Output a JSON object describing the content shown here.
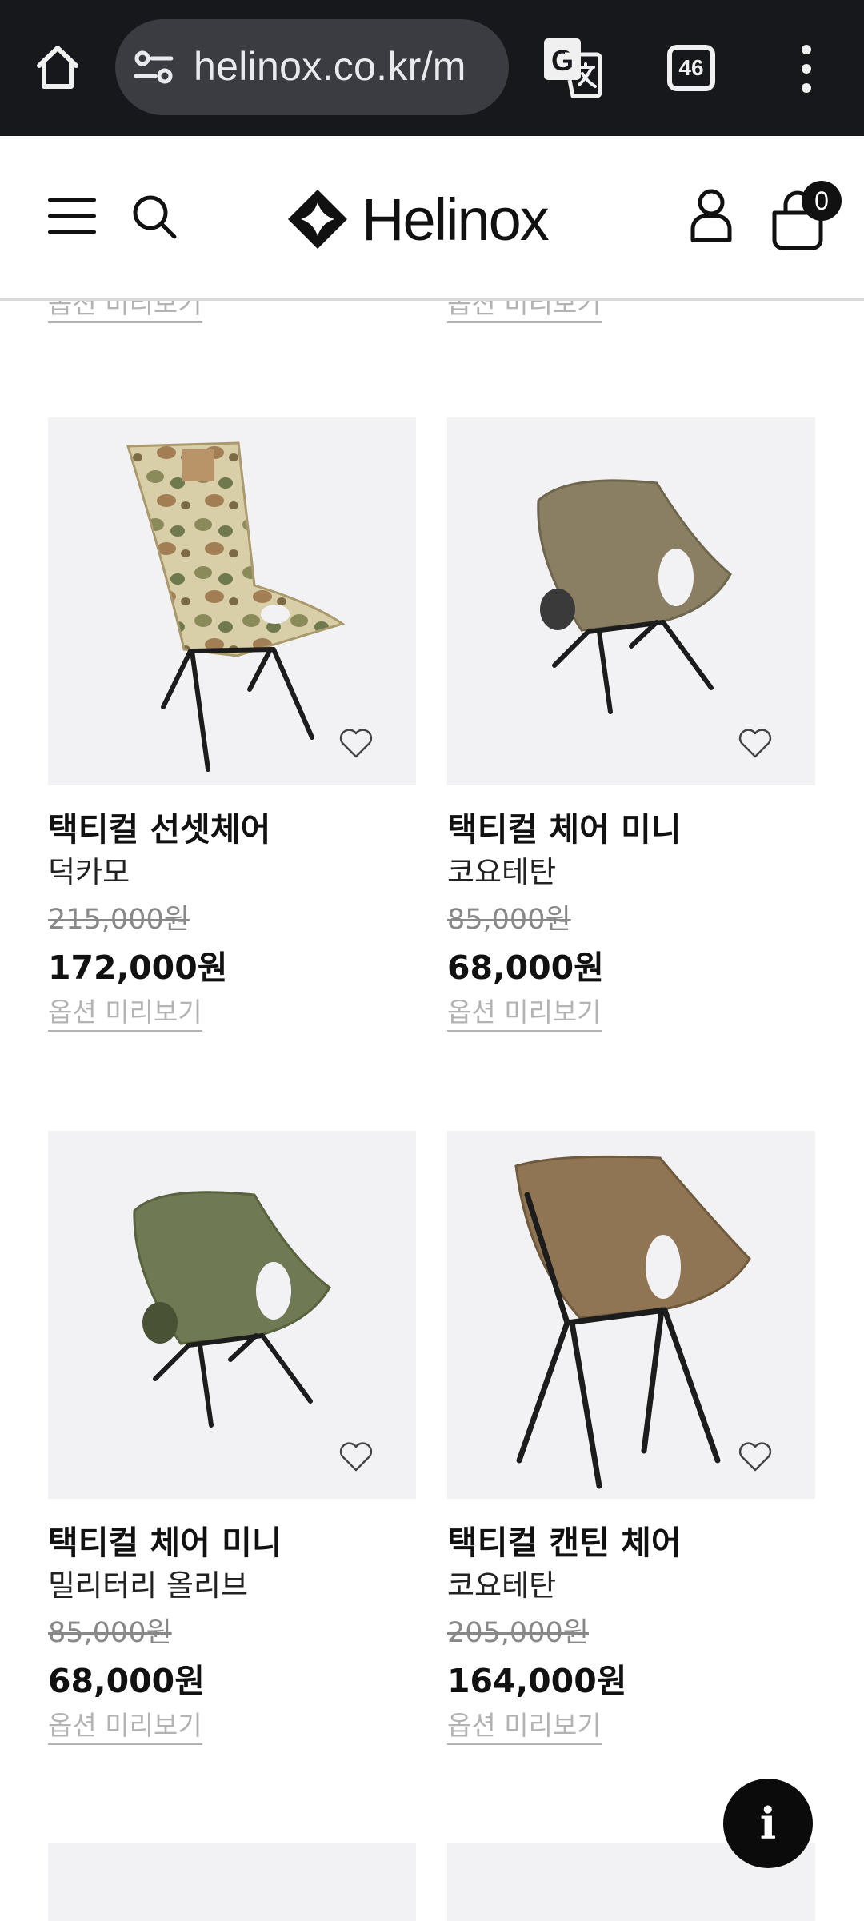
{
  "browser": {
    "url": "helinox.co.kr/m",
    "tab_count": "46"
  },
  "header": {
    "logo_text": "Helinox",
    "cart_count": "0"
  },
  "option_preview_label": "옵션 미리보기",
  "products": [
    {
      "name": "택티컬 선셋체어",
      "color": "덕카모",
      "original_price": "215,000원",
      "sale_price": "172,000원",
      "option_label": "옵션 미리보기",
      "fabric_color": "#c9b98e"
    },
    {
      "name": "택티컬 체어 미니",
      "color": "코요테탄",
      "original_price": "85,000원",
      "sale_price": "68,000원",
      "option_label": "옵션 미리보기",
      "fabric_color": "#8a7f63"
    },
    {
      "name": "택티컬 체어 미니",
      "color": "밀리터리 올리브",
      "original_price": "85,000원",
      "sale_price": "68,000원",
      "option_label": "옵션 미리보기",
      "fabric_color": "#6f7a55"
    },
    {
      "name": "택티컬 캔틴 체어",
      "color": "코요테탄",
      "original_price": "205,000원",
      "sale_price": "164,000원",
      "option_label": "옵션 미리보기",
      "fabric_color": "#8f7553"
    }
  ],
  "colors": {
    "browser_bar": "#17181c",
    "url_pill": "#3b3c41",
    "image_bg": "#f2f2f4",
    "muted_link": "#b3b3b3"
  }
}
